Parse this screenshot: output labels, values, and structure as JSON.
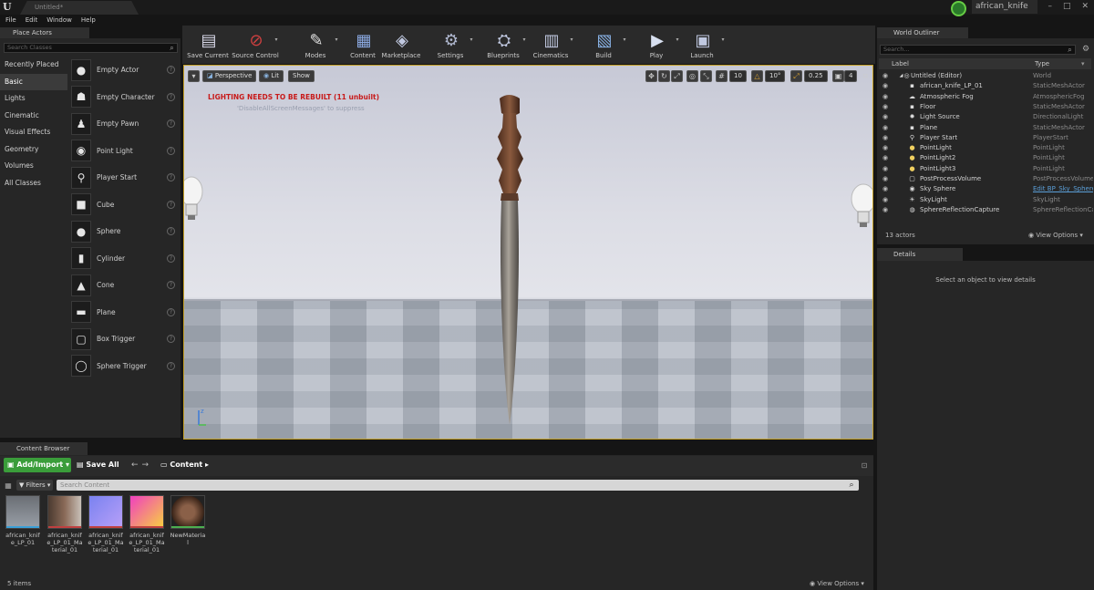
{
  "titlebar": {
    "logo": "U",
    "document_tab": "Untitled*",
    "project_name": "african_knife",
    "window_controls": [
      "–",
      "□",
      "✕"
    ]
  },
  "menu": [
    "File",
    "Edit",
    "Window",
    "Help"
  ],
  "place_actors": {
    "tab_label": "Place Actors",
    "search_placeholder": "Search Classes",
    "categories": [
      "Recently Placed",
      "Basic",
      "Lights",
      "Cinematic",
      "Visual Effects",
      "Geometry",
      "Volumes",
      "All Classes"
    ],
    "active_category": "Basic",
    "actors": [
      {
        "label": "Empty Actor",
        "icon": "sphere-icon"
      },
      {
        "label": "Empty Character",
        "icon": "character-icon"
      },
      {
        "label": "Empty Pawn",
        "icon": "pawn-icon"
      },
      {
        "label": "Point Light",
        "icon": "light-bulb-icon"
      },
      {
        "label": "Player Start",
        "icon": "player-start-icon"
      },
      {
        "label": "Cube",
        "icon": "cube-icon"
      },
      {
        "label": "Sphere",
        "icon": "sphere-icon"
      },
      {
        "label": "Cylinder",
        "icon": "cylinder-icon"
      },
      {
        "label": "Cone",
        "icon": "cone-icon"
      },
      {
        "label": "Plane",
        "icon": "plane-icon"
      },
      {
        "label": "Box Trigger",
        "icon": "box-trigger-icon"
      },
      {
        "label": "Sphere Trigger",
        "icon": "sphere-trigger-icon"
      }
    ]
  },
  "toolbar": {
    "buttons": [
      {
        "label": "Save Current",
        "icon": "save-icon"
      },
      {
        "label": "Source Control",
        "icon": "source-control-icon"
      },
      {
        "label": "Modes",
        "icon": "modes-icon"
      },
      {
        "label": "Content",
        "icon": "content-icon"
      },
      {
        "label": "Marketplace",
        "icon": "marketplace-icon"
      },
      {
        "label": "Settings",
        "icon": "settings-icon"
      },
      {
        "label": "Blueprints",
        "icon": "blueprints-icon"
      },
      {
        "label": "Cinematics",
        "icon": "cinematics-icon"
      },
      {
        "label": "Build",
        "icon": "build-icon"
      },
      {
        "label": "Play",
        "icon": "play-icon"
      },
      {
        "label": "Launch",
        "icon": "launch-icon"
      }
    ]
  },
  "viewport": {
    "view_mode": "Perspective",
    "lit_mode": "Lit",
    "show_label": "Show",
    "grid_snap": "10",
    "rotation_snap": "10°",
    "scale_snap": "0.25",
    "camera_speed": "4",
    "lighting_warning": "LIGHTING NEEDS TO BE REBUILT (11 unbuilt)",
    "suppress_hint": "'DisableAllScreenMessages' to suppress",
    "axis_z": "z"
  },
  "content_browser": {
    "tab_label": "Content Browser",
    "add_import_label": "Add/Import",
    "save_all_label": "Save All",
    "breadcrumb": "Content",
    "filters_label": "Filters",
    "search_placeholder": "Search Content",
    "assets": [
      {
        "label": "african_knife_LP_01",
        "strip_color": "#3aa0d8"
      },
      {
        "label": "african_knife_LP_01_Material_01",
        "strip_color": "#c04040"
      },
      {
        "label": "african_knife_LP_01_Material_01",
        "strip_color": "#c04040"
      },
      {
        "label": "african_knife_LP_01_Material_01",
        "strip_color": "#c04040"
      },
      {
        "label": "NewMaterial",
        "strip_color": "#4caf50"
      }
    ],
    "item_count": "5 items",
    "view_options": "View Options"
  },
  "world_outliner": {
    "tab_label": "World Outliner",
    "search_placeholder": "Search...",
    "col_label": "Label",
    "col_type": "Type",
    "rows": [
      {
        "label": "Untitled (Editor)",
        "type": "World",
        "depth": 0,
        "icon": "world-icon"
      },
      {
        "label": "african_knife_LP_01",
        "type": "StaticMeshActor",
        "depth": 1,
        "icon": "mesh-icon"
      },
      {
        "label": "Atmospheric Fog",
        "type": "AtmosphericFog",
        "depth": 1,
        "icon": "fog-icon"
      },
      {
        "label": "Floor",
        "type": "StaticMeshActor",
        "depth": 1,
        "icon": "mesh-icon"
      },
      {
        "label": "Light Source",
        "type": "DirectionalLight",
        "depth": 1,
        "icon": "directional-light-icon"
      },
      {
        "label": "Plane",
        "type": "StaticMeshActor",
        "depth": 1,
        "icon": "mesh-icon"
      },
      {
        "label": "Player Start",
        "type": "PlayerStart",
        "depth": 1,
        "icon": "player-start-icon"
      },
      {
        "label": "PointLight",
        "type": "PointLight",
        "depth": 1,
        "icon": "point-light-icon"
      },
      {
        "label": "PointLight2",
        "type": "PointLight",
        "depth": 1,
        "icon": "point-light-icon"
      },
      {
        "label": "PointLight3",
        "type": "PointLight",
        "depth": 1,
        "icon": "point-light-icon"
      },
      {
        "label": "PostProcessVolume",
        "type": "PostProcessVolume",
        "depth": 1,
        "icon": "volume-icon"
      },
      {
        "label": "Sky Sphere",
        "type": "Edit BP_Sky_Sphere",
        "depth": 1,
        "icon": "sky-sphere-icon",
        "link": true
      },
      {
        "label": "SkyLight",
        "type": "SkyLight",
        "depth": 1,
        "icon": "skylight-icon"
      },
      {
        "label": "SphereReflectionCapture",
        "type": "SphereReflectionCapture",
        "depth": 1,
        "icon": "reflection-capture-icon"
      }
    ],
    "actor_count": "13 actors",
    "view_options": "View Options"
  },
  "details": {
    "tab_label": "Details",
    "empty_message": "Select an object to view details"
  },
  "colors": {
    "accent_green": "#3a9d3a",
    "viewport_border": "#c4a027",
    "warning_red": "#c81a1a",
    "link_blue": "#5b9fd8"
  }
}
